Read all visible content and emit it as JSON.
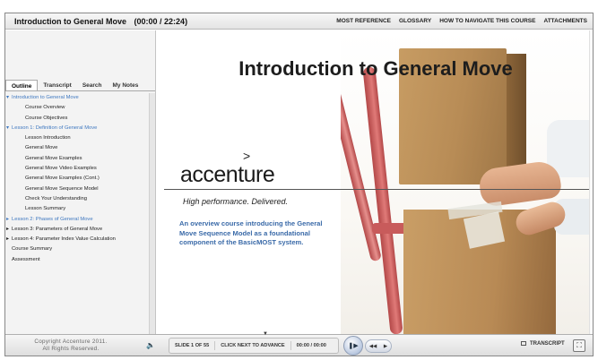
{
  "header": {
    "course_title": "Introduction to General Move",
    "time": "(00:00 / 22:24)",
    "nav": [
      "MOST REFERENCE",
      "GLOSSARY",
      "HOW TO NAVIGATE THIS COURSE",
      "ATTACHMENTS"
    ]
  },
  "sidebar": {
    "tabs": [
      "Outline",
      "Transcript",
      "Search",
      "My Notes"
    ],
    "active_tab": "Outline",
    "outline": [
      {
        "label": "Introduction to General Move",
        "level": 0,
        "state": "expanded",
        "highlight": true
      },
      {
        "label": "Course Overview",
        "level": 1,
        "highlight": false
      },
      {
        "label": "Course Objectives",
        "level": 1,
        "highlight": false
      },
      {
        "label": "Lesson 1:  Definition of General Move",
        "level": 0,
        "state": "expanded",
        "highlight": true
      },
      {
        "label": "Lesson Introduction",
        "level": 1,
        "highlight": false
      },
      {
        "label": "General Move",
        "level": 1,
        "highlight": false
      },
      {
        "label": "General Move Examples",
        "level": 1,
        "highlight": false
      },
      {
        "label": "General Move Video Examples",
        "level": 1,
        "highlight": false
      },
      {
        "label": "General Move Examples (Cont.)",
        "level": 1,
        "highlight": false
      },
      {
        "label": "General Move Sequence Model",
        "level": 1,
        "highlight": false
      },
      {
        "label": "Check Your Understanding",
        "level": 1,
        "highlight": false
      },
      {
        "label": "Lesson Summary",
        "level": 1,
        "highlight": false
      },
      {
        "label": "Lesson 2:  Phases of General Move",
        "level": 0,
        "state": "collapsed",
        "highlight": true
      },
      {
        "label": "Lesson 3:  Parameters of General Move",
        "level": 0,
        "state": "collapsed",
        "highlight": false
      },
      {
        "label": "Lesson 4:  Parameter Index Value Calculation",
        "level": 0,
        "state": "collapsed",
        "highlight": false
      },
      {
        "label": "Course Summary",
        "level": 0,
        "state": "none",
        "highlight": false
      },
      {
        "label": "Assessment",
        "level": 0,
        "state": "none",
        "highlight": false
      }
    ]
  },
  "slide": {
    "title": "Introduction to General Move",
    "logo_mark": ">",
    "logo": "accenture",
    "tagline": "High performance. Delivered.",
    "description": "An overview course introducing the General Move Sequence Model as a foundational component of the BasicMOST system."
  },
  "footer": {
    "copyright_line1": "Copyright Accenture 2011.",
    "copyright_line2": "All Rights Reserved.",
    "volume_icon": "speaker-icon",
    "slide_counter": "SLIDE 1 OF 55",
    "advance_hint": "CLICK NEXT TO ADVANCE",
    "slide_time": "00:00 / 00:00",
    "play_icon": "play-pause-icon",
    "prev_icon": "prev-icon",
    "next_icon": "next-icon",
    "transcript_label": "TRANSCRIPT",
    "fullscreen_icon": "fullscreen-icon"
  },
  "colors": {
    "outline_highlight": "#3f78c0",
    "description_text": "#3a6aa8",
    "dolly": "#c85b5b"
  }
}
